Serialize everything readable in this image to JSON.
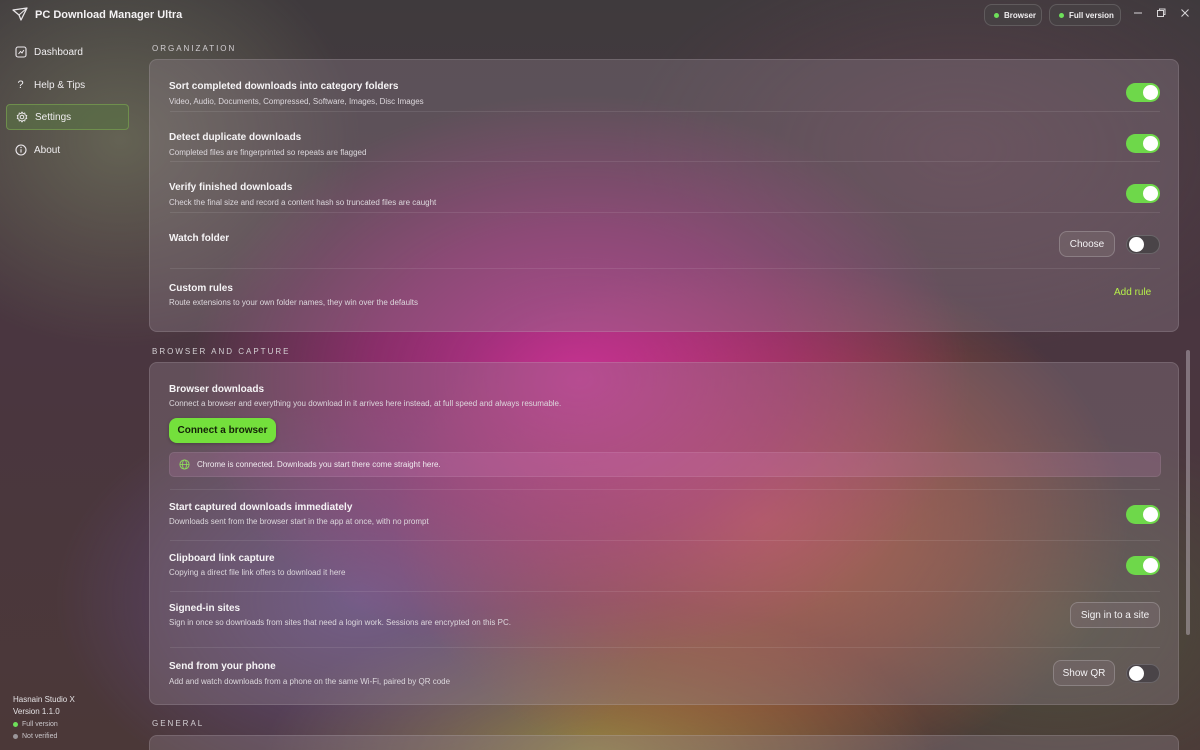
{
  "app": {
    "title": "PC Download Manager Ultra"
  },
  "titlebar": {
    "browser_pill": "Browser",
    "full_version_pill": "Full version",
    "status_color": "#6ee05a"
  },
  "sidebar": {
    "items": [
      {
        "label": "Dashboard",
        "icon": "dashboard-icon"
      },
      {
        "label": "Help & Tips",
        "icon": "question-icon"
      },
      {
        "label": "Settings",
        "icon": "gear-icon",
        "active": true
      },
      {
        "label": "About",
        "icon": "info-icon"
      }
    ],
    "footer": {
      "studio": "Hasnain Studio X",
      "version": "Version 1.1.0",
      "license": "Full version",
      "verification": "Not verified"
    }
  },
  "organization": {
    "section_label": "ORGANIZATION",
    "rows": [
      {
        "title": "Sort completed downloads into category folders",
        "desc": "Video, Audio, Documents, Compressed, Software, Images, Disc Images",
        "toggle": true
      },
      {
        "title": "Detect duplicate downloads",
        "desc": "Completed files are fingerprinted so repeats are flagged",
        "toggle": true
      },
      {
        "title": "Verify finished downloads",
        "desc": "Check the final size and record a content hash so truncated files are caught",
        "toggle": true
      },
      {
        "title": "Watch folder",
        "button": "Choose",
        "toggle": false
      },
      {
        "title": "Custom rules",
        "desc": "Route extensions to your own folder names, they win over the defaults",
        "link": "Add rule"
      }
    ]
  },
  "browser_capture": {
    "section_label": "BROWSER AND CAPTURE",
    "browser_downloads": {
      "title": "Browser downloads",
      "desc": "Connect a browser and everything you download in it arrives here instead, at full speed and always resumable.",
      "button": "Connect a browser",
      "status": "Chrome is connected. Downloads you start there come straight here."
    },
    "rows": [
      {
        "title": "Start captured downloads immediately",
        "desc": "Downloads sent from the browser start in the app at once, with no prompt",
        "toggle": true
      },
      {
        "title": "Clipboard link capture",
        "desc": "Copying a direct file link offers to download it here",
        "toggle": true
      },
      {
        "title": "Signed-in sites",
        "desc": "Sign in once so downloads from sites that need a login work. Sessions are encrypted on this PC.",
        "button": "Sign in to a site"
      },
      {
        "title": "Send from your phone",
        "desc": "Add and watch downloads from a phone on the same Wi-Fi, paired by QR code",
        "button": "Show QR",
        "toggle": false
      }
    ]
  },
  "general": {
    "section_label": "GENERAL"
  },
  "colors": {
    "accent": "#6ed84a",
    "link": "#b6f04a",
    "active_nav": "#5a6e46"
  }
}
